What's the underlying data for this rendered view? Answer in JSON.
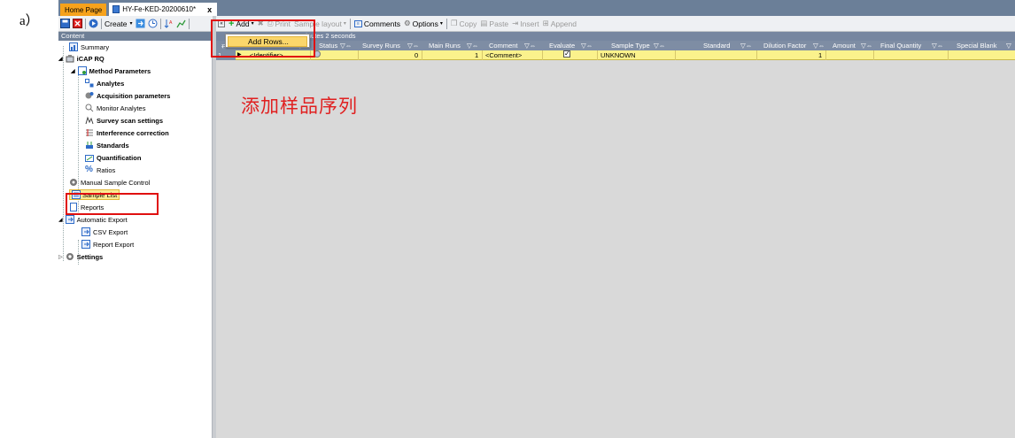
{
  "figure_label": "a）",
  "tabs": [
    {
      "label": "Home Page"
    },
    {
      "label": "HY-Fe-KED-20200610*",
      "close": "x"
    }
  ],
  "left_toolbar": {
    "create_label": "Create"
  },
  "left_panel": {
    "header": "Content",
    "tree": [
      {
        "label": "Summary",
        "icon": "summary-icon"
      },
      {
        "label": "iCAP RQ",
        "icon": "instrument-icon",
        "bold": true
      },
      {
        "label": "Method Parameters",
        "icon": "method-icon",
        "bold": true
      },
      {
        "label": "Analytes",
        "icon": "analytes-icon",
        "bold": true
      },
      {
        "label": "Acquisition parameters",
        "icon": "acquisition-icon",
        "bold": true
      },
      {
        "label": "Monitor Analytes",
        "icon": "monitor-icon"
      },
      {
        "label": "Survey scan settings",
        "icon": "survey-icon",
        "bold": true
      },
      {
        "label": "Interference correction",
        "icon": "interference-icon",
        "bold": true
      },
      {
        "label": "Standards",
        "icon": "standards-icon",
        "bold": true
      },
      {
        "label": "Quantification",
        "icon": "quantification-icon",
        "bold": true
      },
      {
        "label": "Ratios",
        "icon": "ratios-icon"
      },
      {
        "label": "Manual Sample Control",
        "icon": "manual-control-icon"
      },
      {
        "label": "Sample List",
        "icon": "sample-list-icon",
        "selected": true
      },
      {
        "label": "Reports",
        "icon": "reports-icon"
      },
      {
        "label": "Automatic Export",
        "icon": "export-icon"
      },
      {
        "label": "CSV Export",
        "icon": "csv-export-icon"
      },
      {
        "label": "Report Export",
        "icon": "report-export-icon"
      },
      {
        "label": "Settings",
        "icon": "settings-icon",
        "bold": true
      }
    ]
  },
  "right_toolbar": {
    "add": "Add",
    "print": "Print",
    "sample_layout": "Sample layout",
    "comments": "Comments",
    "options": "Options",
    "copy": "Copy",
    "paste": "Paste",
    "insert": "Insert",
    "append": "Append"
  },
  "menu": {
    "add_rows": "Add Rows..."
  },
  "info_text": "me: 10 minutes 2 seconds",
  "grid": {
    "columns": [
      "Label",
      "Status",
      "Survey Runs",
      "Main Runs",
      "Comment",
      "Evaluate",
      "Sample Type",
      "Standard",
      "Dilution Factor",
      "Amount",
      "Final Quantity",
      "Special Blank"
    ],
    "rows": [
      {
        "num": "1",
        "label": "<Identifier>",
        "survey_runs": "0",
        "main_runs": "1",
        "comment": "<Comment>",
        "evaluate": true,
        "sample_type": "UNKNOWN",
        "dilution_factor": "1"
      }
    ]
  },
  "annotation": "添加样品序列",
  "colors": {
    "highlight": "#e01010",
    "tab_active": "#f6a21c",
    "row_selected": "#fbf28c",
    "header_bg": "#7e8da4"
  }
}
